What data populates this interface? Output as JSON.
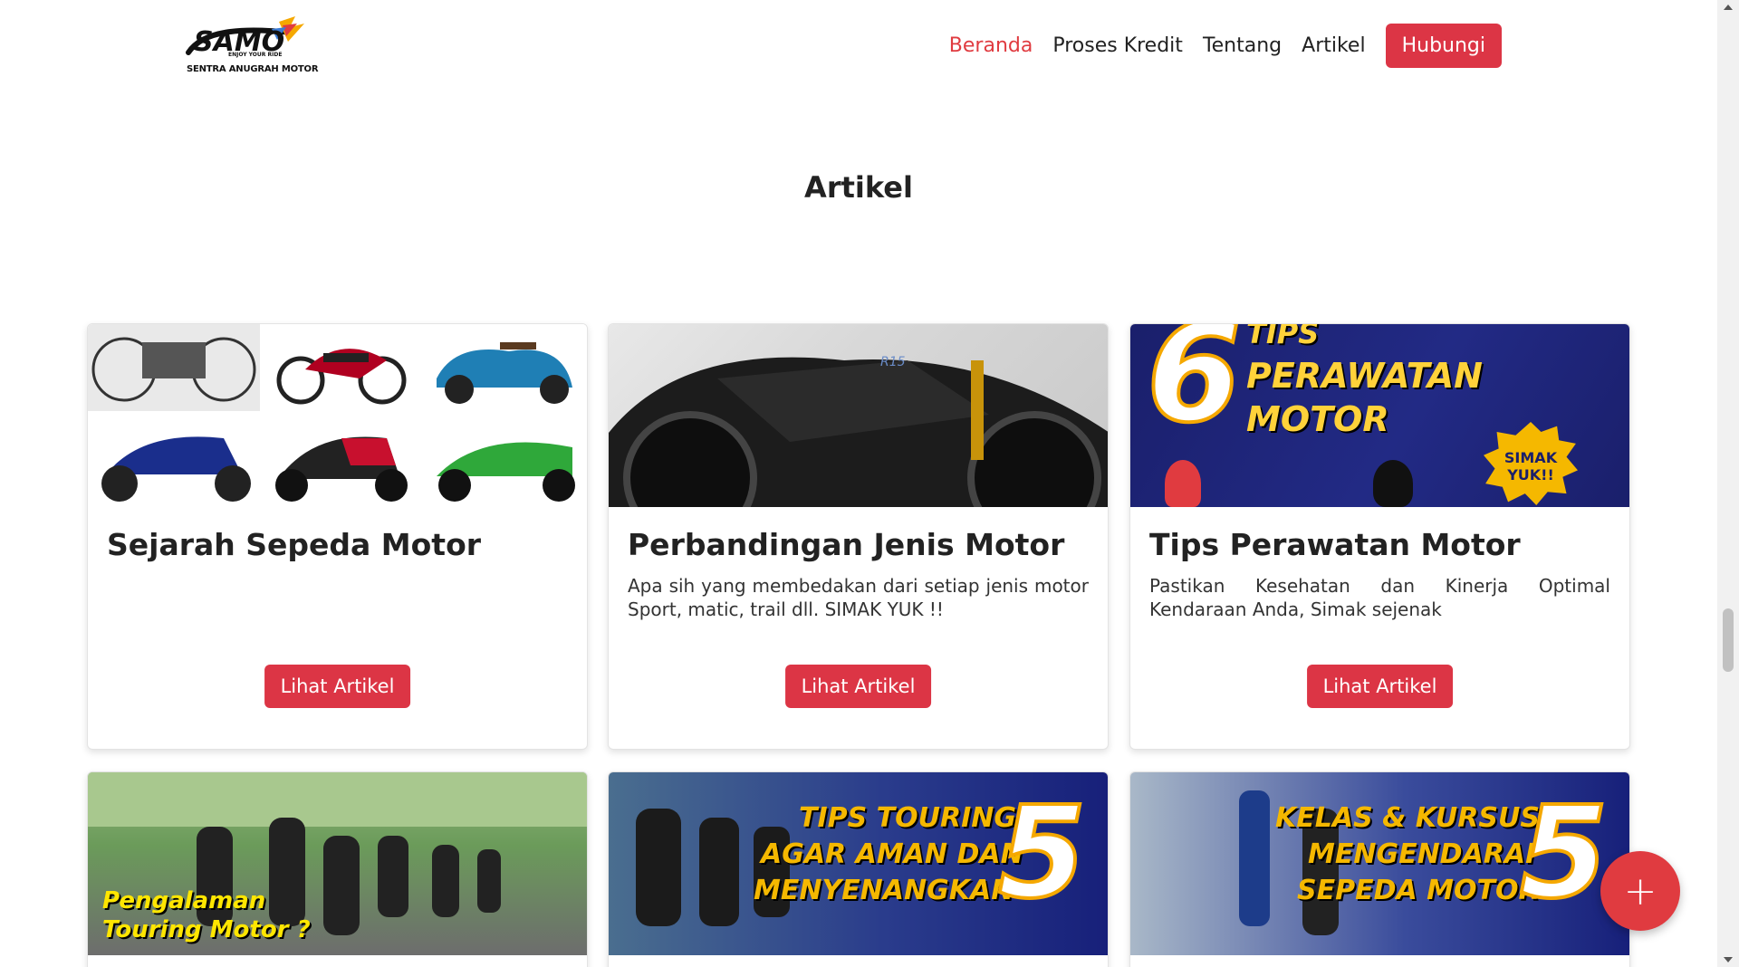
{
  "header": {
    "logo_text": "SAMO",
    "logo_tagline": "ENJOY YOUR RIDE",
    "logo_subtitle": "SENTRA ANUGRAH MOTOR",
    "nav": {
      "beranda": "Beranda",
      "proses_kredit": "Proses Kredit",
      "tentang": "Tentang",
      "artikel": "Artikel",
      "hubungi": "Hubungi"
    }
  },
  "section": {
    "title": "Artikel"
  },
  "cards": [
    {
      "title": "Sejarah Sepeda Motor",
      "description": "",
      "button": "Lihat Artikel"
    },
    {
      "title": "Perbandingan Jenis Motor",
      "description": "Apa sih yang membedakan dari setiap jenis motor Sport, matic, trail dll. SIMAK YUK !!",
      "button": "Lihat Artikel",
      "image_text": "R15"
    },
    {
      "title": "Tips Perawatan Motor",
      "description": "Pastikan Kesehatan dan Kinerja Optimal Kendaraan Anda, Simak sejenak",
      "button": "Lihat Artikel",
      "image_number": "6",
      "image_line1": "TIPS",
      "image_line2": "PERAWATAN",
      "image_line3": "MOTOR",
      "image_badge_1": "SIMAK",
      "image_badge_2": "YUK!!"
    },
    {
      "image_line1": "Pengalaman",
      "image_line2": "Touring Motor ?"
    },
    {
      "image_line1": "TIPS TOURING",
      "image_line2": "AGAR AMAN DAN",
      "image_line3": "MENYENANGKAN",
      "image_number": "5"
    },
    {
      "image_line1": "KELAS & KURSUS",
      "image_line2": "MENGENDARAI",
      "image_line3": "SEPEDA MOTOR",
      "image_number": "5"
    }
  ],
  "fab": {
    "icon": "plus-icon",
    "label": "+"
  },
  "colors": {
    "accent": "#dc3545",
    "nav_active": "#e03b40",
    "navy": "#1a1f6b",
    "yellow": "#f5b800"
  }
}
